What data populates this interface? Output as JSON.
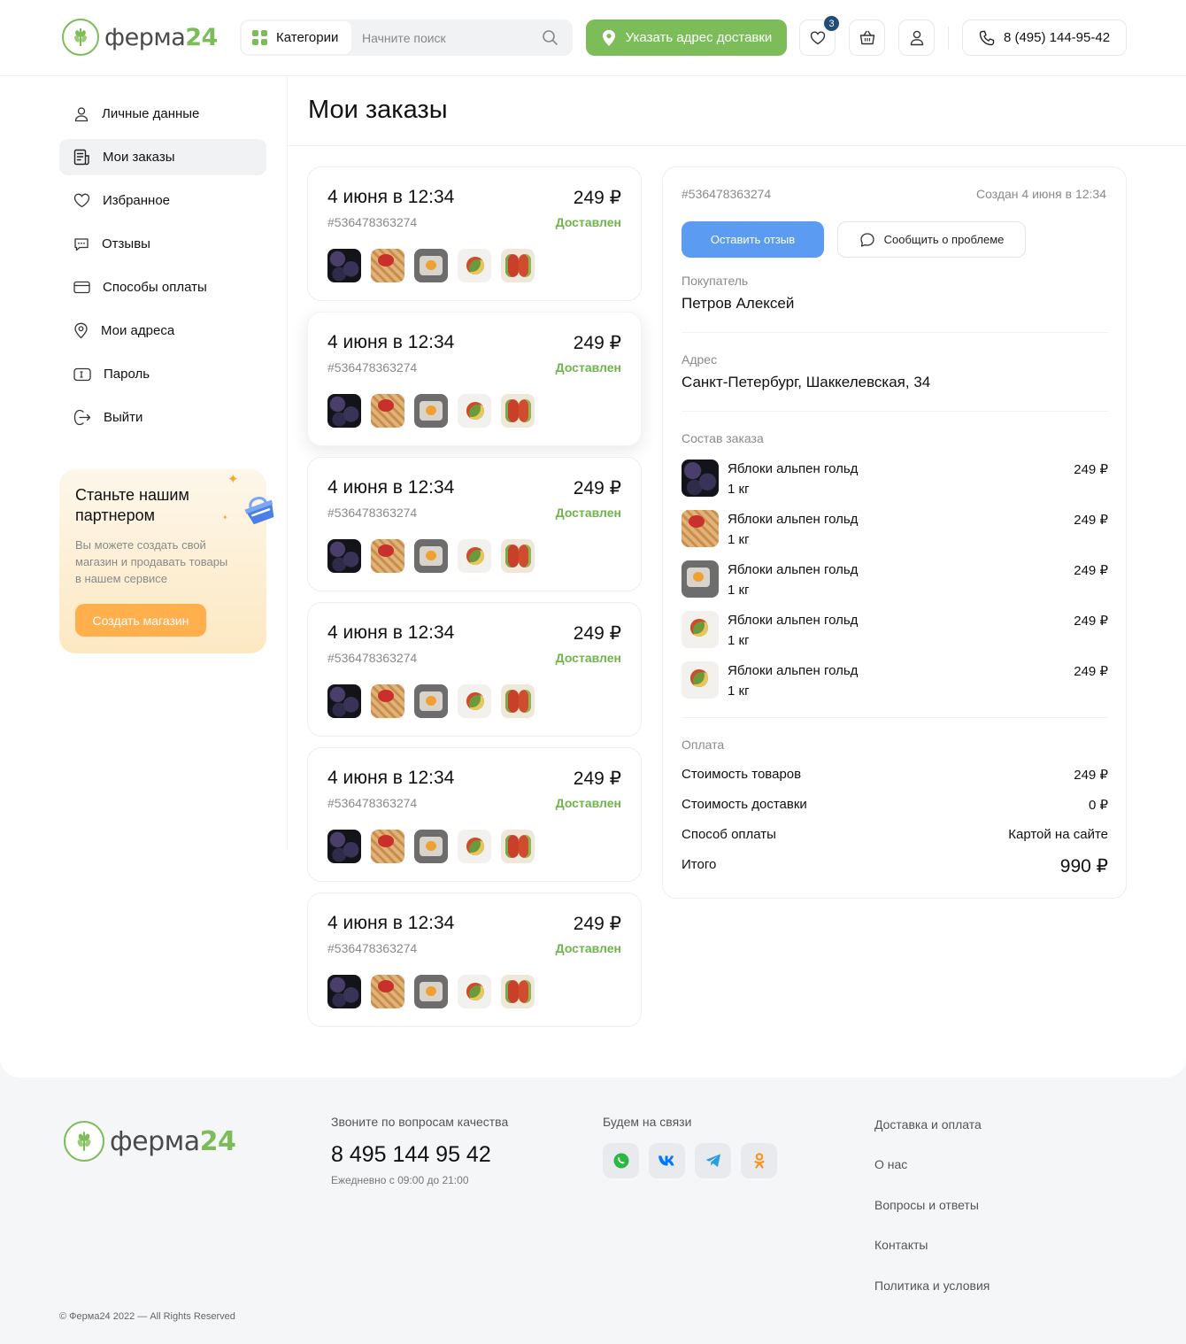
{
  "header": {
    "logo_text": "ферма",
    "logo_num": "24",
    "categories_label": "Категории",
    "search_placeholder": "Начните поиск",
    "delivery_button": "Указать адрес доставки",
    "favorites_count": "3",
    "phone": "8 (495) 144-95-42",
    "accent_color": "#7cbd5a"
  },
  "sidebar": {
    "items": [
      {
        "label": "Личные данные",
        "icon": "user-icon"
      },
      {
        "label": "Мои заказы",
        "icon": "orders-icon",
        "active": true
      },
      {
        "label": "Избранное",
        "icon": "heart-icon"
      },
      {
        "label": "Отзывы",
        "icon": "chat-icon"
      },
      {
        "label": "Способы оплаты",
        "icon": "card-icon"
      },
      {
        "label": "Мои адреса",
        "icon": "location-icon"
      },
      {
        "label": "Пароль",
        "icon": "password-icon"
      },
      {
        "label": "Выйти",
        "icon": "logout-icon"
      }
    ],
    "partner": {
      "title": "Станьте нашим партнером",
      "text": "Вы можете создать свой магазин и продавать товары в нашем сервисе",
      "button": "Создать магазин"
    }
  },
  "page_title": "Мои заказы",
  "orders": [
    {
      "date": "4 июня в 12:34",
      "number": "#536478363274",
      "price": "249 ₽",
      "status": "Доставлен"
    },
    {
      "date": "4 июня в 12:34",
      "number": "#536478363274",
      "price": "249 ₽",
      "status": "Доставлен"
    },
    {
      "date": "4 июня в 12:34",
      "number": "#536478363274",
      "price": "249 ₽",
      "status": "Доставлен"
    },
    {
      "date": "4 июня в 12:34",
      "number": "#536478363274",
      "price": "249 ₽",
      "status": "Доставлен"
    },
    {
      "date": "4 июня в 12:34",
      "number": "#536478363274",
      "price": "249 ₽",
      "status": "Доставлен"
    },
    {
      "date": "4 июня в 12:34",
      "number": "#536478363274",
      "price": "249 ₽",
      "status": "Доставлен"
    }
  ],
  "detail": {
    "number": "#536478363274",
    "created": "Создан 4 июня в 12:34",
    "review_button": "Оставить отзыв",
    "problem_button": "Сообщить о проблеме",
    "buyer_label": "Покупатель",
    "buyer": "Петров Алексей",
    "address_label": "Адрес",
    "address": "Санкт-Петербург, Шаккелевская, 34",
    "composition_label": "Состав заказа",
    "items": [
      {
        "name": "Яблоки альпен гольд",
        "qty": "1 кг",
        "price": "249 ₽"
      },
      {
        "name": "Яблоки альпен гольд",
        "qty": "1 кг",
        "price": "249 ₽"
      },
      {
        "name": "Яблоки альпен гольд",
        "qty": "1 кг",
        "price": "249 ₽"
      },
      {
        "name": "Яблоки альпен гольд",
        "qty": "1 кг",
        "price": "249 ₽"
      },
      {
        "name": "Яблоки альпен гольд",
        "qty": "1 кг",
        "price": "249 ₽"
      }
    ],
    "payment_label": "Оплата",
    "goods_cost_label": "Стоимость товаров",
    "goods_cost": "249 ₽",
    "delivery_cost_label": "Стоимость доставки",
    "delivery_cost": "0 ₽",
    "pay_method_label": "Способ оплаты",
    "pay_method": "Картой на сайте",
    "total_label": "Итого",
    "total": "990 ₽"
  },
  "footer": {
    "quality_title": "Звоните по вопросам качества",
    "phone": "8 495 144 95 42",
    "hours": "Ежедневно с 09:00 до 21:00",
    "social_title": "Будем на связи",
    "links": [
      "Доставка и оплата",
      "О нас",
      "Вопросы и ответы",
      "Контакты",
      "Политика и условия"
    ],
    "copyright": "© Ферма24 2022 — All Rights Reserved"
  }
}
